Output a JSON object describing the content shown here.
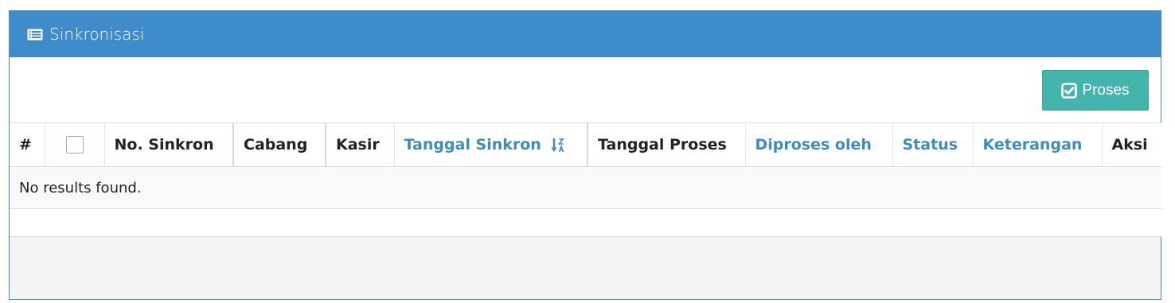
{
  "panel": {
    "title": "Sinkronisasi",
    "title_icon": "list-alt-icon"
  },
  "toolbar": {
    "proses_label": "Proses",
    "proses_icon": "check-square-icon"
  },
  "table": {
    "columns": {
      "index": "#",
      "no_sinkron": "No. Sinkron",
      "cabang": "Cabang",
      "kasir": "Kasir",
      "tanggal_sinkron": "Tanggal Sinkron",
      "tanggal_proses": "Tanggal Proses",
      "diproses_oleh": "Diproses oleh",
      "status": "Status",
      "keterangan": "Keterangan",
      "aksi": "Aksi"
    },
    "sort_icon": "sort-alpha-desc-icon",
    "empty_text": "No results found."
  },
  "colors": {
    "header_bg": "#3f8ccb",
    "button_bg": "#44b5ad",
    "link": "#3c8dbc"
  }
}
